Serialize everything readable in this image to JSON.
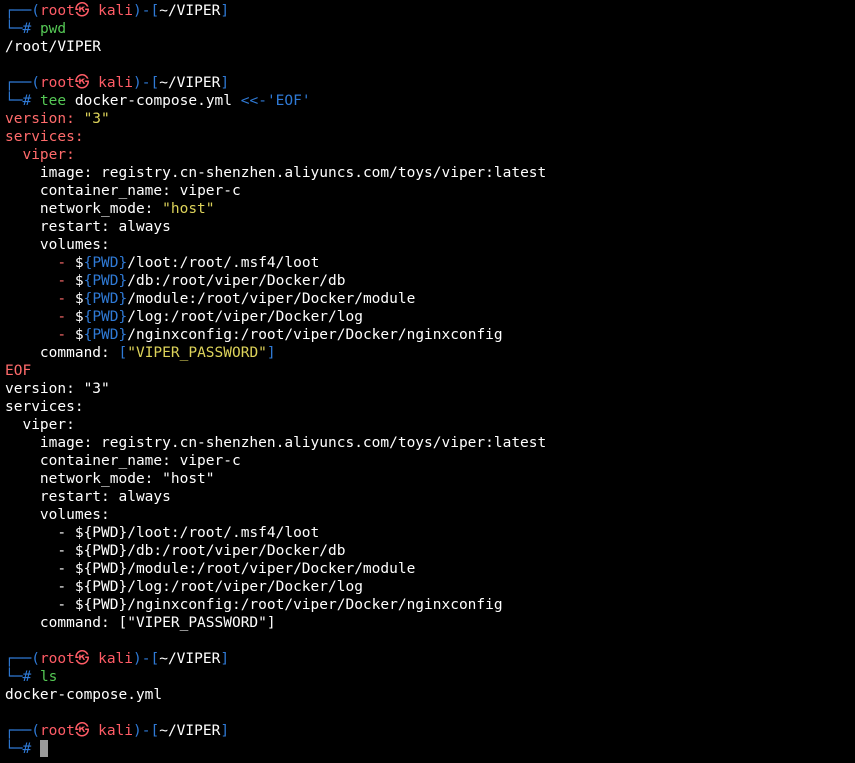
{
  "prompt": {
    "top_corner": "┌──",
    "open_paren": "(",
    "user": "root",
    "at_symbol": "㉿",
    "host": "kali",
    "close_paren": ")",
    "dash": "-",
    "open_bracket": "[",
    "path": "~/VIPER",
    "close_bracket": "]",
    "bottom_corner": "└─",
    "hash": "#"
  },
  "sessions": {
    "pwd": {
      "command": "pwd",
      "output": "/root/VIPER"
    },
    "tee": {
      "cmd_name": "tee",
      "cmd_args": "docker-compose.yml",
      "heredoc": "<<-'EOF'",
      "input": {
        "l1_key": "version:",
        "l1_val": "\"3\"",
        "l2_key": "services:",
        "l3_key": "  viper:",
        "l4_key": "    image:",
        "l4_val": "registry.cn-shenzhen.aliyuncs.com/toys/viper:latest",
        "l5_key": "    container_name:",
        "l5_val": "viper-c",
        "l6_key": "    network_mode:",
        "l6_val": "\"host\"",
        "l7_key": "    restart:",
        "l7_val": "always",
        "l8_key": "    volumes:",
        "dash": "- ",
        "dollar": "$",
        "pwd_var": "{PWD}",
        "v1": "/loot:/root/.msf4/loot",
        "v2": "/db:/root/viper/Docker/db",
        "v3": "/module:/root/viper/Docker/module",
        "v4": "/log:/root/viper/Docker/log",
        "v5": "/nginxconfig:/root/viper/Docker/nginxconfig",
        "l14_key": "    command:",
        "l14_open": "[",
        "l14_val": "\"VIPER_PASSWORD\"",
        "l14_close": "]",
        "eof": "EOF"
      },
      "output": [
        "version: \"3\"",
        "services:",
        "  viper:",
        "    image: registry.cn-shenzhen.aliyuncs.com/toys/viper:latest",
        "    container_name: viper-c",
        "    network_mode: \"host\"",
        "    restart: always",
        "    volumes:",
        "      - ${PWD}/loot:/root/.msf4/loot",
        "      - ${PWD}/db:/root/viper/Docker/db",
        "      - ${PWD}/module:/root/viper/Docker/module",
        "      - ${PWD}/log:/root/viper/Docker/log",
        "      - ${PWD}/nginxconfig:/root/viper/Docker/nginxconfig",
        "    command: [\"VIPER_PASSWORD\"]"
      ]
    },
    "ls": {
      "command": "ls",
      "output": "docker-compose.yml"
    }
  },
  "colors": {
    "background": "#000000",
    "prompt_frame": "#2f7ad6",
    "prompt_user_host": "#ff5c66",
    "command": "#55c855",
    "yaml_key": "#ff6b6b",
    "string": "#ddd35a",
    "text": "#ffffff",
    "cursor": "#9a9a9a"
  }
}
